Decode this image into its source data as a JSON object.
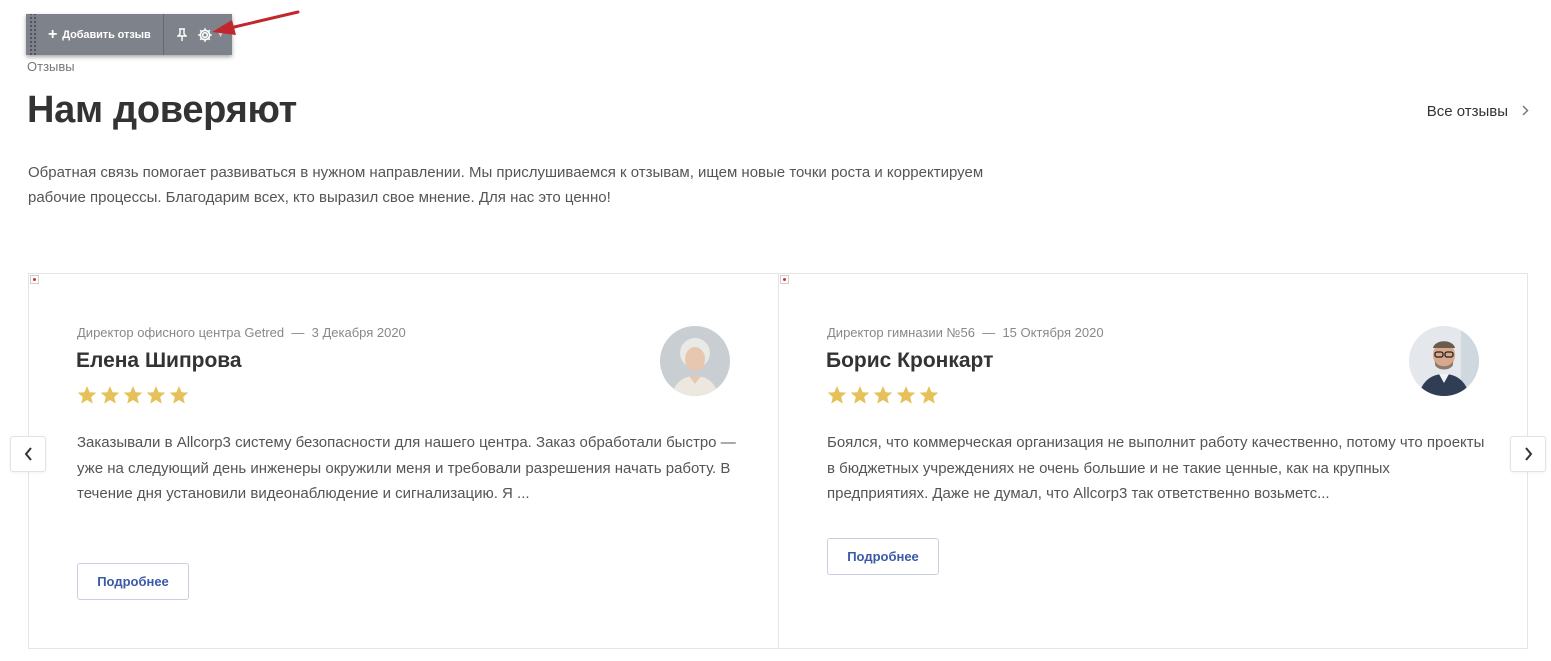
{
  "toolbar": {
    "add_label": "Добавить отзыв"
  },
  "section": {
    "eyebrow": "Отзывы",
    "title": "Нам доверяют",
    "all_link": "Все отзывы",
    "description": "Обратная связь помогает развиваться в нужном направлении. Мы прислушиваемся к отзывам, ищем новые точки роста и корректируем рабочие процессы. Благодарим всех, кто выразил свое мнение. Для нас это ценно!"
  },
  "reviews": [
    {
      "position": "Директор офисного центра Getred",
      "date": "3 Декабря 2020",
      "name": "Елена Шипрова",
      "rating": 5,
      "text": "Заказывали в Allcorp3 систему безопасности для нашего центра. Заказ обработали быстро — уже на следующий день инженеры окружили меня и требовали разрешения начать работу. В течение дня установили видеонаблюдение и сигнализацию. Я ...",
      "more_label": "Подробнее"
    },
    {
      "position": "Директор гимназии №56",
      "date": "15 Октября 2020",
      "name": "Борис Кронкарт",
      "rating": 5,
      "text": "Боялся, что коммерческая организация не выполнит работу качественно, потому что проекты в бюджетных учреждениях не очень большие и не такие ценные, как на крупных предприятиях. Даже не думал, что Allcorp3 так ответственно возьметс...",
      "more_label": "Подробнее"
    }
  ],
  "colors": {
    "accent": "#3a5aa8",
    "star": "#e6c15a",
    "toolbar": "#7d828b",
    "arrow": "#c1272d"
  },
  "icons": [
    "plus-icon",
    "pin-icon",
    "gear-icon",
    "chevron-right-icon",
    "chevron-left-icon",
    "star-icon"
  ]
}
